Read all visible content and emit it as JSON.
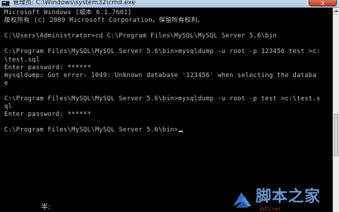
{
  "window": {
    "title": "管理员: C:\\Windows\\system32\\cmd.exe",
    "close_glyph": "x"
  },
  "console": {
    "lines": [
      "Microsoft Windows [版本 6.1.7601]",
      "版权所有 (c) 2009 Microsoft Corporation。保留所有权利。",
      "",
      "C:\\Users\\Administrator>cd C:\\Program Files\\MySQL\\MySQL Server 5.6\\bin",
      "",
      "C:\\Program Files\\MySQL\\MySQL Server 5.6\\bin>mysqldump -u root -p 123456 test >c:",
      "\\test.sql",
      "Enter password: ******",
      "mysqldump: Got error: 1049: Unknown database '123456' when selecting the databa",
      "e",
      "",
      "C:\\Program Files\\MySQL\\MySQL Server 5.6\\bin>mysqldump -u root -p test >c:\\test.s",
      "ql",
      "Enter password: ******",
      "",
      "C:\\Program Files\\MySQL\\MySQL Server 5.6\\bin>"
    ]
  },
  "taskbar": {
    "fragment_text": "半:"
  },
  "watermark": {
    "text": "脚本之家",
    "subtext": "jb51.net"
  },
  "icons": {
    "app": "cmd-icon",
    "close": "close-icon",
    "scroll_up": "arrow-up-icon",
    "watermark": "logo-icon"
  },
  "colors": {
    "console_background": "#000000",
    "console_text": "#c0c0c0",
    "titlebar": "#c9d9ee",
    "close_button": "#c23a22",
    "watermark_text": "#7aa7e8"
  }
}
